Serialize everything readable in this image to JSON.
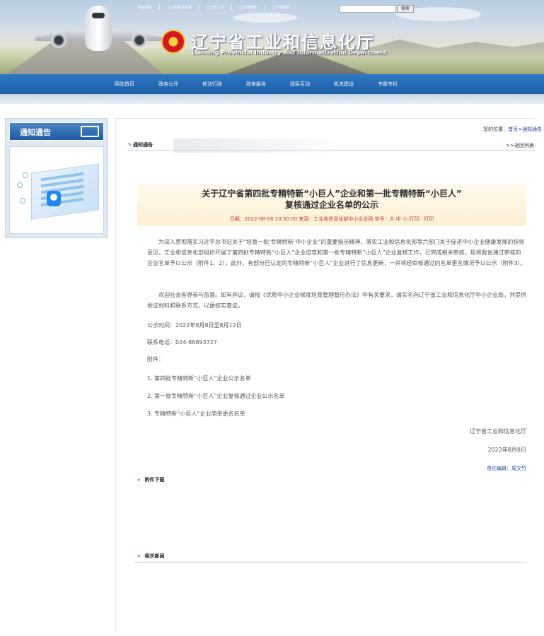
{
  "header": {
    "site_title": "辽宁省工业和信息化厅",
    "site_subtitle": "Liaoning Provincial Industry and Informatization Department",
    "top_links": [
      "网站首页",
      "工业和信息化部",
      "辽宁省人大",
      "辽宁省政府",
      "辽宁省政协"
    ],
    "search": {
      "button": "搜索",
      "value": ""
    }
  },
  "nav": {
    "items": [
      "网站首页",
      "政务公开",
      "依法行政",
      "政务服务",
      "政民互动",
      "机关建设",
      "专题专栏"
    ]
  },
  "sidebar": {
    "title": "通知通告"
  },
  "location": {
    "label": "您的位置：",
    "home": "首页",
    "sep": ">",
    "current": "通知通告"
  },
  "tab": {
    "title": "通知通告",
    "back": ">>返回列表"
  },
  "article": {
    "title_line1": "关于辽宁省第四批专精特新“小巨人”企业和第一批专精特新“小巨人”",
    "title_line2": "复核通过企业名单的公示",
    "meta": "日期：2022-08-08 10:30:00   来源：工业和信息化部中小企业局   字号：大 中 小   打印：打印",
    "paragraphs": [
      "为深入贯彻落实习近平总书记关于“培育一批‘专精特新’中小企业”的重要指示精神，落实工业和信息化部等六部门关于促进中小企业健康发展的指导意见，工业和信息化部组织开展了第四批专精特新“小巨人”企业培育和第一批专精特新“小巨人”企业复核工作，已完成相关审核，现将我省通过审核的企业名单予以公示（附件1、2），此外，有部分已认定的专精特新“小巨人”企业进行了信息更新，一并将经审核通过的名单更名情况予以公示（附件3）。",
      "欢迎社会各界参与监督。如有异议，请按《优质中小企业梯度培育管理暂行办法》中有关要求，请实名向辽宁省工业和信息化厅中小企业局，并提供佐证材料和联系方式，以便核实查证。"
    ],
    "period": "公示时间：2022年8月8日至8月12日",
    "phone": "联系电话：024-86893727",
    "attach_label": "附件：",
    "attachments": [
      "1. 第四批专精特新“小巨人”企业公示名单",
      "2. 第一批专精特新“小巨人”企业复核通过企业公示名单",
      "3. 专精特新“小巨人”企业简单更名名单"
    ],
    "issuer": "辽宁省工业和信息化厅",
    "date": "2022年8月8日",
    "editor": "责任编辑：周文竹"
  },
  "sections": {
    "downloads": "附件下载",
    "related": "相关新闻"
  }
}
